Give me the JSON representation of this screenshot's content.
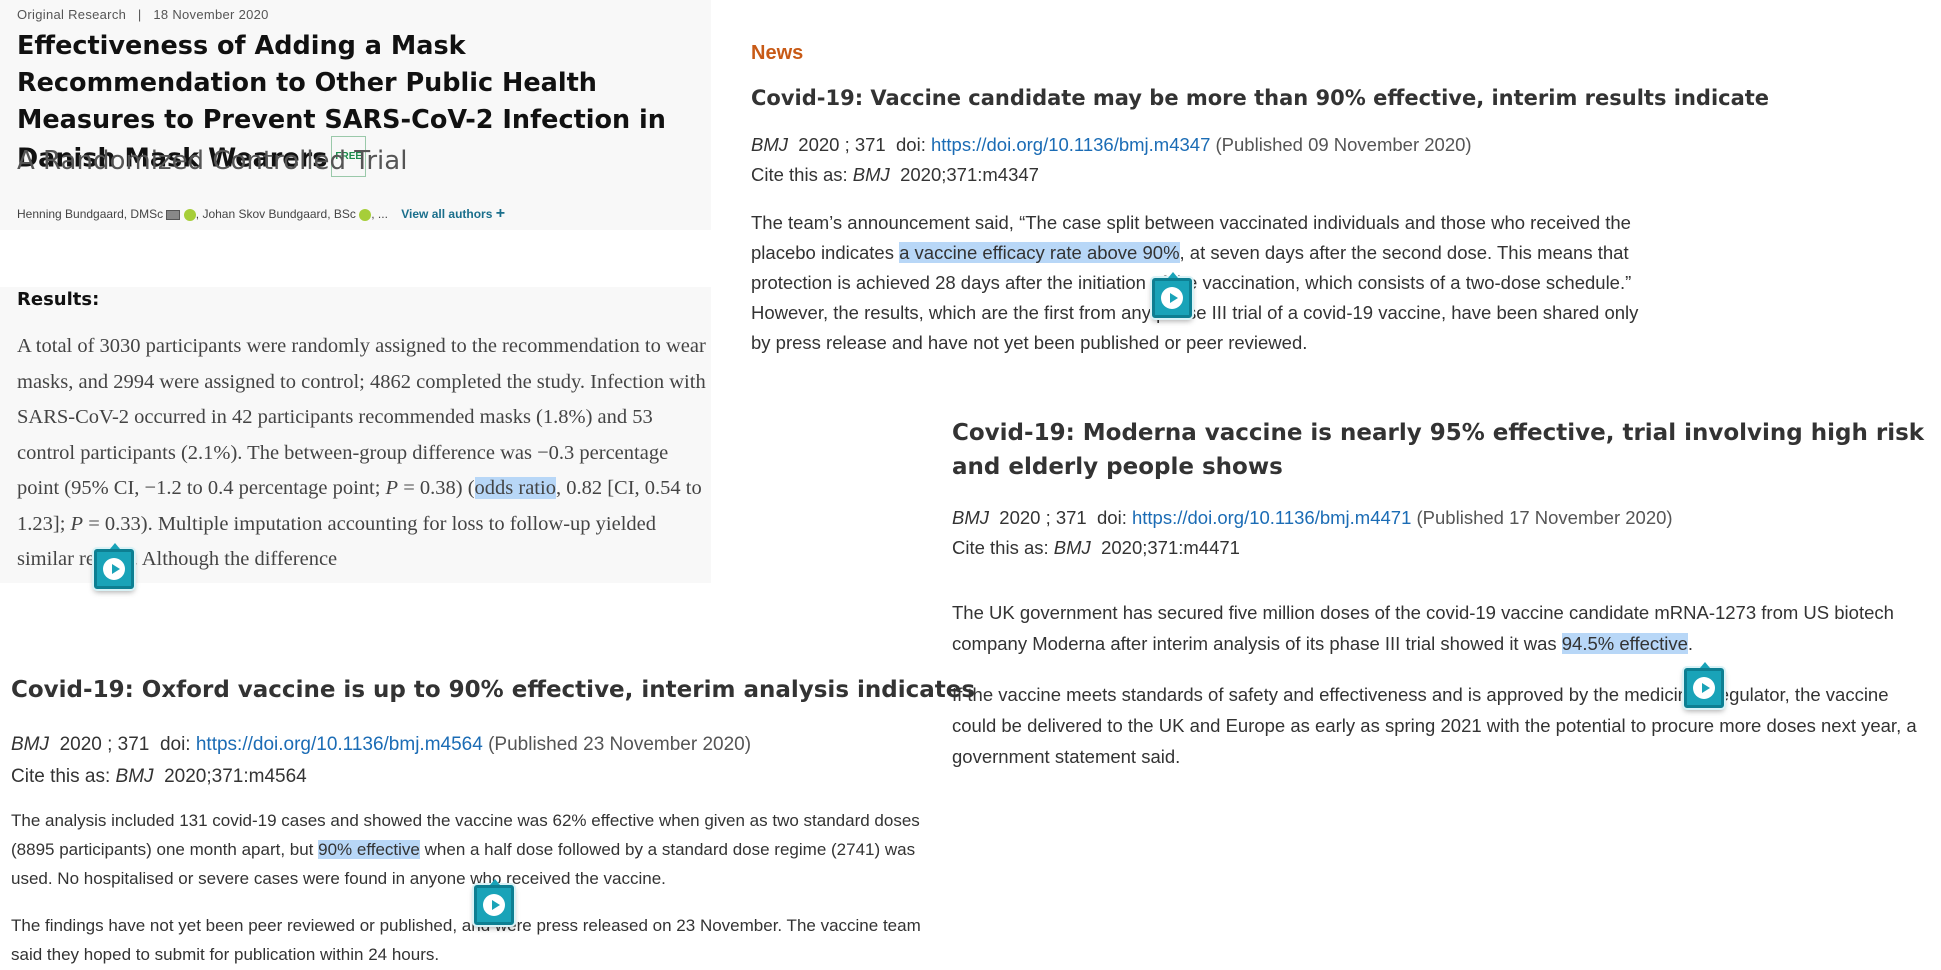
{
  "annals": {
    "category": "Original Research",
    "separator": "|",
    "date": "18 November 2020",
    "title": "Effectiveness of Adding a Mask Recommendation to Other Public Health Measures to Prevent SARS-CoV-2 Infection in Danish Mask Wearers",
    "free_badge": "FREE",
    "subtitle": "A Randomized Controlled Trial",
    "author1": "Henning Bundgaard, DMSc",
    "author2": ", Johan Skov Bundgaard, BSc",
    "author_more": ", ...",
    "view_all": "View all authors",
    "results_heading": "Results:",
    "results_part1": "A total of 3030 participants were randomly assigned to the recommendation to wear masks, and 2994 were assigned to control; 4862 completed the study. Infection with SARS-CoV-2 occurred in 42 participants recommended masks (1.8%) and 53 control participants (2.1%). The between-group difference was −0.3 percentage point (95% CI, −1.2 to 0.4 percentage point; ",
    "results_p_var": "P",
    "results_part2": " = 0.38) (",
    "results_highlight": "odds ratio",
    "results_part3": ", 0.82 [CI, 0.54 to 1.23]; ",
    "results_part4": " = 0.33). Multiple imputation accounting for loss to follow-up yielded similar results. Although the difference"
  },
  "bmj_pfizer": {
    "section": "News",
    "title": "Covid-19: Vaccine candidate may be more than 90% effective, interim results indicate",
    "journal": "BMJ",
    "year_vol": "2020 ; 371",
    "doi_label": "doi:",
    "doi": "https://doi.org/10.1136/bmj.m4347",
    "published": "(Published 09 November 2020)",
    "cite_label": "Cite this as:",
    "cite_value": "2020;371:m4347",
    "body_pre": "The team’s announcement said, “The case split between vaccinated individuals and those who received the placebo indicates ",
    "body_highlight": "a vaccine efficacy rate above 90%",
    "body_post": ", at seven days after the second dose. This means that protection is achieved 28 days after the initiation of the vaccination, which consists of a two-dose schedule.” However, the results, which are the first from any phase III trial of a covid-19 vaccine, have been shared only by press release and have not yet been published or peer reviewed."
  },
  "bmj_moderna": {
    "title": "Covid-19: Moderna vaccine is nearly 95% effective, trial involving high risk and elderly people shows",
    "journal": "BMJ",
    "year_vol": "2020 ; 371",
    "doi_label": "doi:",
    "doi": "https://doi.org/10.1136/bmj.m4471",
    "published": "(Published 17 November 2020)",
    "cite_label": "Cite this as:",
    "cite_value": "2020;371:m4471",
    "p1_pre": "The UK government has secured five million doses of the covid-19 vaccine candidate mRNA-1273 from US biotech company Moderna after interim analysis of its phase III trial showed it was ",
    "p1_highlight": "94.5% effective",
    "p1_post": ".",
    "p2": "If the vaccine meets standards of safety and effectiveness and is approved by the medicines regulator, the vaccine could be delivered to the UK and Europe as early as spring 2021 with the potential to procure more doses next year, a government statement said."
  },
  "bmj_oxford": {
    "title": "Covid-19: Oxford vaccine is up to 90% effective, interim analysis indicates",
    "journal": "BMJ",
    "year_vol": "2020 ; 371",
    "doi_label": "doi:",
    "doi": "https://doi.org/10.1136/bmj.m4564",
    "published": "(Published 23 November 2020)",
    "cite_label": "Cite this as:",
    "cite_value": "2020;371:m4564",
    "p1_pre": "The analysis included 131 covid-19 cases and showed the vaccine was 62% effective when given as two standard doses (8895 participants) one month apart, but ",
    "p1_highlight": "90% effective",
    "p1_post": " when a half dose followed by a standard dose regime (2741) was used. No hospitalised or severe cases were found in anyone who received the vaccine.",
    "p2": "The findings have not yet been peer reviewed or published, and were press released on 23 November. The vaccine team said they hoped to submit for publication within 24 hours."
  },
  "colors": {
    "highlight": "#b8d7f7",
    "link": "#1b6cb5",
    "news": "#c85a16",
    "play_marker": "#19a3b8"
  }
}
